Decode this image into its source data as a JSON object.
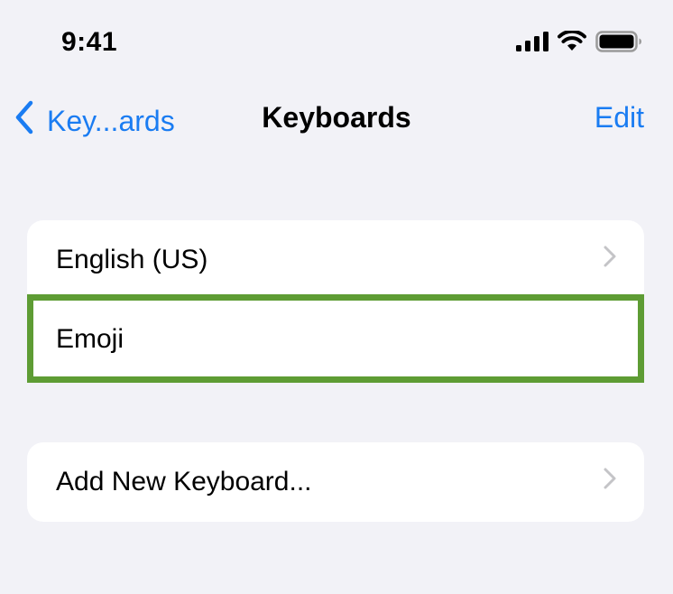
{
  "status_bar": {
    "time": "9:41",
    "icons": [
      "cellular-signal-icon",
      "wifi-icon",
      "battery-icon"
    ]
  },
  "nav": {
    "back_label": "Key...ards",
    "title": "Keyboards",
    "edit_label": "Edit"
  },
  "keyboards": [
    {
      "label": "English (US)",
      "chevron": true
    },
    {
      "label": "Emoji",
      "chevron": false
    }
  ],
  "add_keyboard": {
    "label": "Add New Keyboard..."
  },
  "colors": {
    "background": "#f2f2f7",
    "accent": "#1a7cf2",
    "highlight": "#5e9c34",
    "chevron": "#c4c4c7"
  }
}
